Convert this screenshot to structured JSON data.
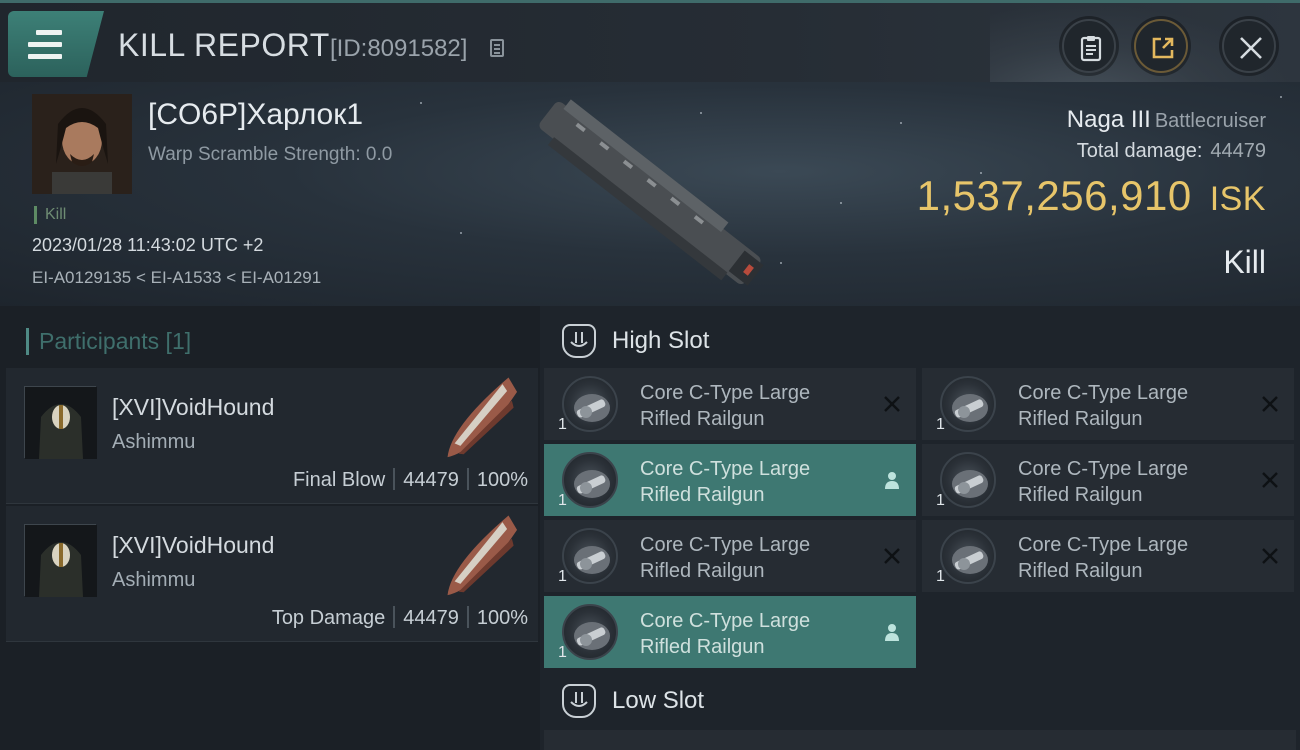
{
  "header": {
    "title": "KILL REPORT",
    "report_id": "[ID:8091582]",
    "icons": {
      "menu": "hamburger-menu-icon",
      "copy": "copy-icon",
      "clipboard": "clipboard-icon",
      "share": "share-icon",
      "close": "close-icon"
    }
  },
  "victim": {
    "name": "[CO6P]Харлок1",
    "warp_scramble": "Warp Scramble Strength: 0.0",
    "tag": "Kill",
    "datetime": "2023/01/28 11:43:02 UTC +2",
    "route": "EI-A0129135 < EI-A1533 < EI-A01291",
    "ship_name": "Naga III",
    "ship_class": "Battlecruiser",
    "total_damage_label": "Total damage:",
    "total_damage": "44479",
    "isk_value": "1,537,256,910",
    "isk_unit": "ISK",
    "result": "Kill"
  },
  "participants": {
    "header": "Participants [1]",
    "cards": [
      {
        "name": "[XVI]VoidHound",
        "ship": "Ashimmu",
        "stat_label": "Final Blow",
        "damage": "44479",
        "percent": "100%"
      },
      {
        "name": "[XVI]VoidHound",
        "ship": "Ashimmu",
        "stat_label": "Top Damage",
        "damage": "44479",
        "percent": "100%"
      }
    ]
  },
  "slots": {
    "high": {
      "label": "High Slot",
      "items": [
        {
          "qty": "1",
          "line1": "Core C-Type Large",
          "line2": "Rifled Railgun",
          "status": "destroyed",
          "active": false
        },
        {
          "qty": "1",
          "line1": "Core C-Type Large",
          "line2": "Rifled Railgun",
          "status": "destroyed",
          "active": false
        },
        {
          "qty": "1",
          "line1": "Core C-Type Large",
          "line2": "Rifled Railgun",
          "status": "dropped",
          "active": true
        },
        {
          "qty": "1",
          "line1": "Core C-Type Large",
          "line2": "Rifled Railgun",
          "status": "destroyed",
          "active": false
        },
        {
          "qty": "1",
          "line1": "Core C-Type Large",
          "line2": "Rifled Railgun",
          "status": "destroyed",
          "active": false
        },
        {
          "qty": "1",
          "line1": "Core C-Type Large",
          "line2": "Rifled Railgun",
          "status": "destroyed",
          "active": false
        },
        {
          "qty": "1",
          "line1": "Core C-Type Large",
          "line2": "Rifled Railgun",
          "status": "dropped",
          "active": true
        }
      ]
    },
    "low": {
      "label": "Low Slot"
    }
  },
  "colors": {
    "accent": "#3e7872",
    "isk": "#e7c56a",
    "panel": "#262c33"
  }
}
